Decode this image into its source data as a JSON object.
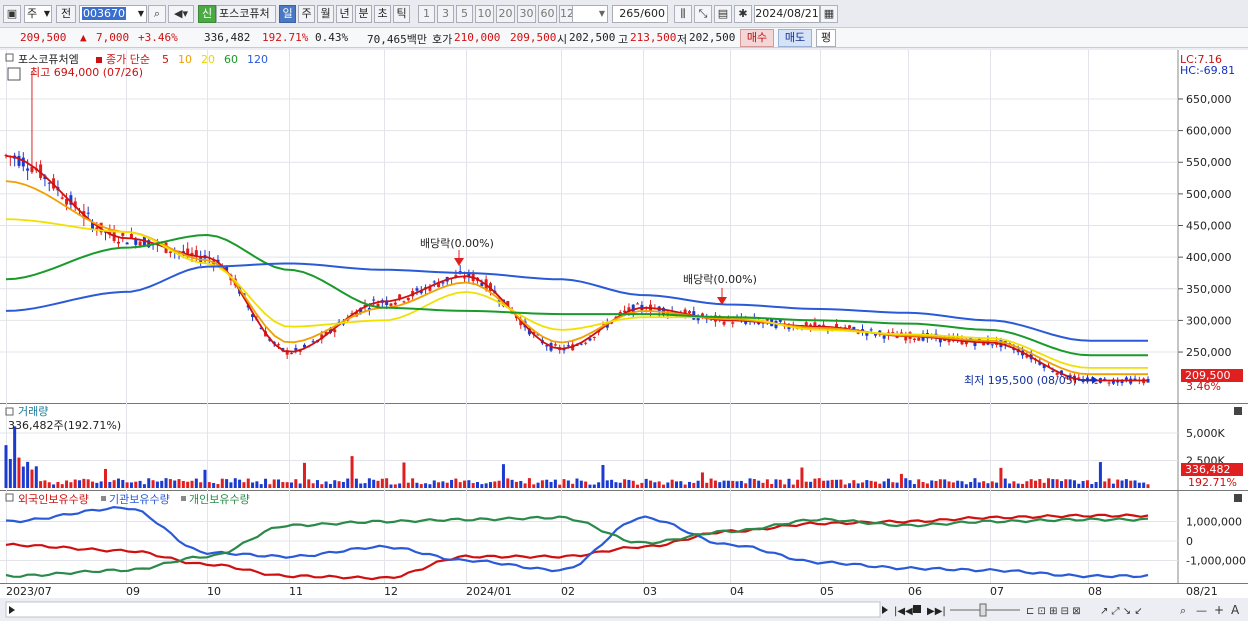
{
  "toolbar": {
    "market": "주",
    "period_type": "전",
    "code": "003670",
    "new_badge": "신",
    "stock_name": "포스코퓨처",
    "period_tabs": [
      "일",
      "주",
      "월",
      "년",
      "분",
      "초",
      "틱"
    ],
    "period_active": "일",
    "intervals": [
      "1",
      "3",
      "5",
      "10",
      "20",
      "30",
      "60",
      "120"
    ],
    "count_value": "265",
    "count_max": "/600",
    "date": "2024/08/21"
  },
  "quote": {
    "price": "209,500",
    "change_arrow": "▲",
    "change": "7,000",
    "change_pct": "+3.46%",
    "volume": "336,482",
    "volume_ratio": "192.71%",
    "turnover": "0.43%",
    "amount": "70,465백만",
    "bid_label": "호가",
    "bid1": "210,000",
    "bid2": "209,500",
    "open_label": "시",
    "open": "202,500",
    "high_label": "고",
    "high": "213,500",
    "low_label": "저",
    "low": "202,500",
    "buy_btn": "매수",
    "sell_btn": "매도",
    "eval_btn": "평"
  },
  "price_pane": {
    "name_label": "포스코퓨처엠",
    "indicator_label": "종가 단순",
    "ma_periods": [
      {
        "label": "5",
        "color": "#d01010"
      },
      {
        "label": "10",
        "color": "#f0a000"
      },
      {
        "label": "20",
        "color": "#e8d800"
      },
      {
        "label": "60",
        "color": "#1a9a2a"
      },
      {
        "label": "120",
        "color": "#2a5ad8"
      }
    ],
    "high_marker": "최고 694,000 (07/26)",
    "low_marker": "최저 195,500 (08/05)",
    "dividend1": "배당락(0.00%)",
    "dividend2": "배당락(0.00%)",
    "lc": "LC:7.16",
    "hc": "HC:-69.81",
    "y_ticks": [
      "650,000",
      "600,000",
      "550,000",
      "500,000",
      "450,000",
      "400,000",
      "350,000",
      "300,000",
      "250,000"
    ],
    "last_price": "209,500",
    "last_pct": "3.46%"
  },
  "volume_pane": {
    "title": "거래량",
    "value": "336,482주(192.71%)",
    "y_ticks": [
      "5,000K",
      "2,500K"
    ],
    "last_value": "336,482",
    "last_pct": "192.71%"
  },
  "holding_pane": {
    "series": [
      {
        "label": "외국인보유수량",
        "color": "#d01010"
      },
      {
        "label": "기관보유수량",
        "color": "#2a5ad8"
      },
      {
        "label": "개인보유수량",
        "color": "#2a8a4a"
      }
    ],
    "y_ticks": [
      "1,000,000",
      "0",
      "-1,000,000"
    ]
  },
  "x_axis": {
    "labels": [
      "2023/07",
      "09",
      "10",
      "11",
      "12",
      "2024/01",
      "02",
      "03",
      "04",
      "05",
      "06",
      "07",
      "08"
    ],
    "right_label": "08/21"
  },
  "chart_data": {
    "type": "line",
    "x": [
      "2023/07",
      "09",
      "10",
      "11",
      "12",
      "2024/01",
      "02",
      "03",
      "04",
      "05",
      "06",
      "07",
      "08"
    ],
    "series": [
      {
        "name": "5",
        "values": [
          560000,
          430000,
          400000,
          250000,
          330000,
          370000,
          255000,
          320000,
          300000,
          290000,
          275000,
          265000,
          205000
        ]
      },
      {
        "name": "10",
        "values": [
          520000,
          440000,
          395000,
          265000,
          320000,
          360000,
          265000,
          315000,
          302000,
          288000,
          276000,
          268000,
          215000
        ]
      },
      {
        "name": "20",
        "values": [
          460000,
          440000,
          390000,
          290000,
          300000,
          345000,
          285000,
          305000,
          305000,
          285000,
          278000,
          272000,
          225000
        ]
      },
      {
        "name": "60",
        "values": [
          365000,
          415000,
          435000,
          380000,
          320000,
          315000,
          310000,
          310000,
          305000,
          300000,
          295000,
          285000,
          245000
        ]
      },
      {
        "name": "120",
        "values": [
          315000,
          345000,
          385000,
          390000,
          380000,
          375000,
          365000,
          340000,
          325000,
          318000,
          312000,
          300000,
          268000
        ]
      }
    ],
    "ylim": [
      200000,
      694000
    ],
    "holdings": [
      {
        "name": "외국인보유수량",
        "values": [
          -200000,
          -500000,
          -1200000,
          -1800000,
          -1900000,
          -800000,
          -800000,
          -300000,
          500000,
          900000,
          1000000,
          1200000,
          1300000
        ]
      },
      {
        "name": "기관보유수량",
        "values": [
          1000000,
          1700000,
          -600000,
          -800000,
          -300000,
          -1000000,
          -1500000,
          1200000,
          -200000,
          -1100000,
          -1400000,
          -1500000,
          -1800000
        ]
      },
      {
        "name": "개인보유수량",
        "values": [
          -1800000,
          -1500000,
          -800000,
          800000,
          1000000,
          1100000,
          1200000,
          -100000,
          500000,
          1100000,
          800000,
          1000000,
          1100000
        ]
      }
    ]
  }
}
